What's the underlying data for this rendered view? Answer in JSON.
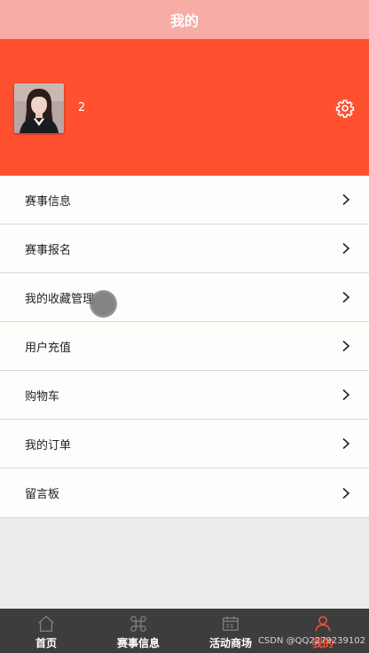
{
  "header": {
    "title": "我的"
  },
  "profile": {
    "username": "2",
    "banner_color": "#ff512f"
  },
  "menu": {
    "items": [
      {
        "label": "赛事信息"
      },
      {
        "label": "赛事报名"
      },
      {
        "label": "我的收藏管理"
      },
      {
        "label": "用户充值"
      },
      {
        "label": "购物车"
      },
      {
        "label": "我的订单"
      },
      {
        "label": "留言板"
      }
    ]
  },
  "tabbar": {
    "tabs": [
      {
        "label": "首页",
        "icon": "home-icon"
      },
      {
        "label": "赛事信息",
        "icon": "command-icon"
      },
      {
        "label": "活动商场",
        "icon": "calendar-icon"
      },
      {
        "label": "我的",
        "icon": "user-icon",
        "active": true
      }
    ],
    "active_color": "#ff512f"
  },
  "watermark": {
    "text": "CSDN @QQ2279239102"
  }
}
